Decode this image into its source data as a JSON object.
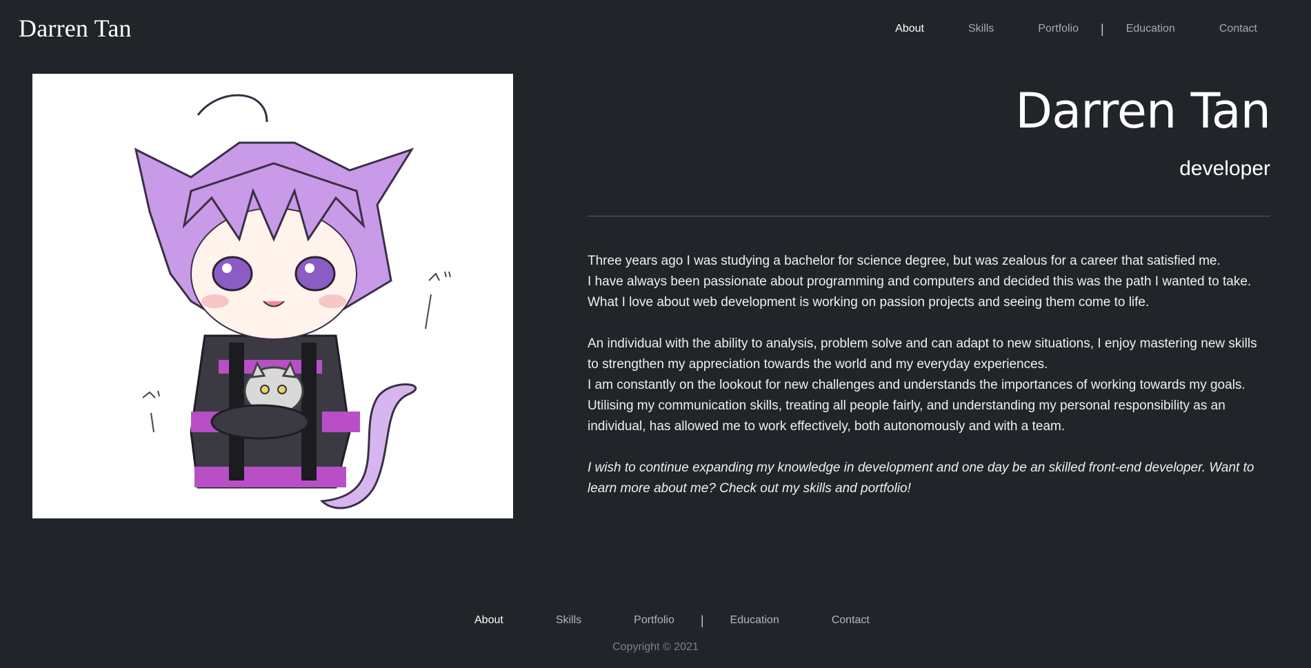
{
  "header": {
    "brand": "Darren Tan",
    "nav": [
      {
        "label": "About",
        "active": true
      },
      {
        "label": "Skills",
        "active": false
      },
      {
        "label": "Portfolio",
        "active": false
      },
      {
        "label": "|",
        "separator": true
      },
      {
        "label": "Education",
        "active": false
      },
      {
        "label": "Contact",
        "active": false
      }
    ]
  },
  "hero": {
    "name": "Darren Tan",
    "title": "developer",
    "image_icon": "chibi-catgirl-avatar"
  },
  "bio": {
    "paragraph1": [
      "Three years ago I was studying a bachelor for science degree, but was zealous for a career that satisfied me.",
      "I have always been passionate about programming and computers and decided this was the path I wanted to take.",
      "What I love about web development is working on passion projects and seeing them come to life."
    ],
    "paragraph2": [
      "An individual with the ability to analysis, problem solve and can adapt to new situations, I enjoy mastering new skills to strengthen my appreciation towards the world and my everyday experiences.",
      "I am constantly on the lookout for new challenges and understands the importances of working towards my goals.",
      "Utilising my communication skills, treating all people fairly, and understanding my personal responsibility as an individual, has allowed me to work effectively, both autonomously and with a team."
    ],
    "paragraph3": "I wish to continue expanding my knowledge in development and one day be an skilled front-end developer. Want to learn more about me? Check out my skills and portfolio!"
  },
  "footer": {
    "nav": [
      {
        "label": "About",
        "active": true
      },
      {
        "label": "Skills",
        "active": false
      },
      {
        "label": "Portfolio",
        "active": false
      },
      {
        "label": "|",
        "separator": true
      },
      {
        "label": "Education",
        "active": false
      },
      {
        "label": "Contact",
        "active": false
      }
    ],
    "copyright": "Copyright © 2021"
  },
  "colors": {
    "background": "#212429",
    "text": "#ffffff",
    "muted": "#a7acb2",
    "divider": "#5b6067"
  }
}
